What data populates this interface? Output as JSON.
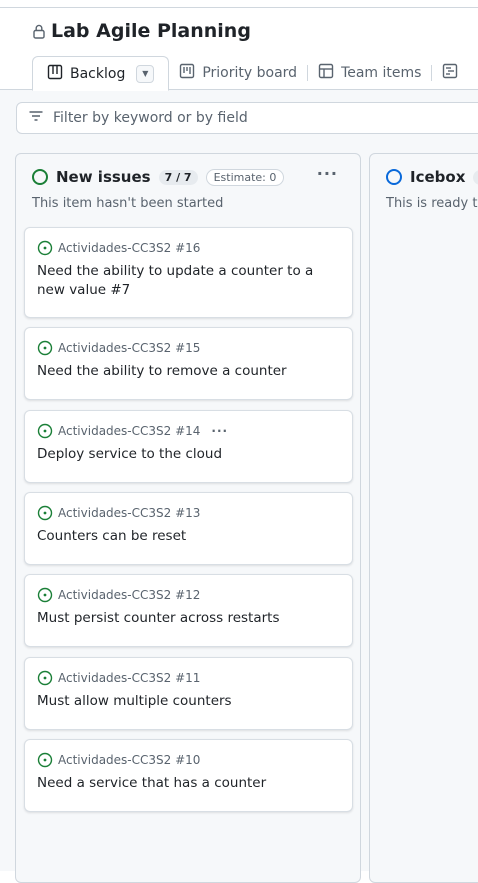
{
  "project": {
    "title": "Lab Agile Planning",
    "icon": "lock-icon"
  },
  "tabs": [
    {
      "label": "Backlog",
      "icon": "table-icon",
      "active": true
    },
    {
      "label": "Priority board",
      "icon": "board-icon"
    },
    {
      "label": "Team items",
      "icon": "table-icon"
    }
  ],
  "filter": {
    "placeholder": "Filter by keyword or by field",
    "icon": "filter-icon"
  },
  "columns": [
    {
      "name": "New issues",
      "count": "7 / 7",
      "estimate": "Estimate: 0",
      "description": "This item hasn't been started",
      "status_color": "#1a7f37",
      "menu": "···",
      "cards": [
        {
          "repo": "Actividades-CC3S2 #16",
          "title": "Need the ability to update a counter to a new value #7"
        },
        {
          "repo": "Actividades-CC3S2 #15",
          "title": "Need the ability to remove a counter"
        },
        {
          "repo": "Actividades-CC3S2 #14",
          "title": "Deploy service to the cloud",
          "menu": "···"
        },
        {
          "repo": "Actividades-CC3S2 #13",
          "title": "Counters can be reset"
        },
        {
          "repo": "Actividades-CC3S2 #12",
          "title": "Must persist counter across restarts"
        },
        {
          "repo": "Actividades-CC3S2 #11",
          "title": "Must allow multiple counters"
        },
        {
          "repo": "Actividades-CC3S2 #10",
          "title": "Need a service that has a counter"
        }
      ]
    },
    {
      "name": "Icebox",
      "description": "This is ready to",
      "status_color": "#0969da"
    }
  ],
  "colors": {
    "open_issue": "#1a7f37",
    "icebox": "#0969da",
    "border": "#d0d7de",
    "board_bg": "#f6f8fa"
  }
}
